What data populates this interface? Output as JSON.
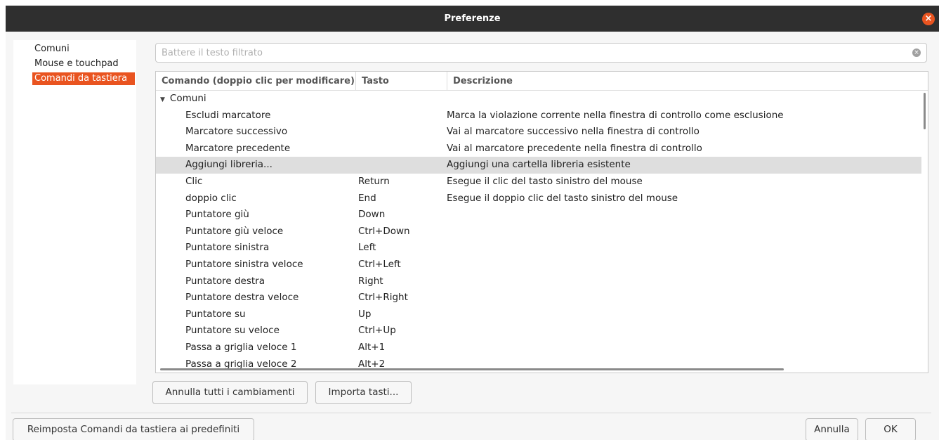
{
  "window": {
    "title": "Preferenze"
  },
  "sidebar": {
    "items": [
      {
        "label": "Comuni"
      },
      {
        "label": "Mouse e touchpad"
      },
      {
        "label": "Comandi da tastiera"
      }
    ],
    "active_index": 2
  },
  "filter": {
    "placeholder": "Battere il testo filtrato",
    "value": ""
  },
  "table": {
    "columns": [
      "Comando (doppio clic per modificare)",
      "Tasto",
      "Descrizione"
    ],
    "group": "Comuni",
    "rows": [
      {
        "command": "Escludi marcatore",
        "key": "",
        "description": "Marca la violazione corrente nella finestra di controllo come esclusione"
      },
      {
        "command": "Marcatore successivo",
        "key": "",
        "description": "Vai al marcatore successivo nella finestra di controllo"
      },
      {
        "command": "Marcatore precedente",
        "key": "",
        "description": "Vai al marcatore precedente nella finestra di controllo"
      },
      {
        "command": "Aggiungi libreria...",
        "key": "",
        "description": "Aggiungi una cartella libreria esistente",
        "selected": true
      },
      {
        "command": "Clic",
        "key": "Return",
        "description": "Esegue il clic del tasto sinistro del mouse"
      },
      {
        "command": "doppio clic",
        "key": "End",
        "description": "Esegue il doppio clic del tasto sinistro del mouse"
      },
      {
        "command": "Puntatore giù",
        "key": "Down",
        "description": ""
      },
      {
        "command": "Puntatore giù veloce",
        "key": "Ctrl+Down",
        "description": ""
      },
      {
        "command": "Puntatore sinistra",
        "key": "Left",
        "description": ""
      },
      {
        "command": "Puntatore sinistra veloce",
        "key": "Ctrl+Left",
        "description": ""
      },
      {
        "command": "Puntatore destra",
        "key": "Right",
        "description": ""
      },
      {
        "command": "Puntatore destra veloce",
        "key": "Ctrl+Right",
        "description": ""
      },
      {
        "command": "Puntatore su",
        "key": "Up",
        "description": ""
      },
      {
        "command": "Puntatore su veloce",
        "key": "Ctrl+Up",
        "description": ""
      },
      {
        "command": "Passa a griglia veloce 1",
        "key": "Alt+1",
        "description": ""
      },
      {
        "command": "Passa a griglia veloce 2",
        "key": "Alt+2",
        "description": ""
      }
    ]
  },
  "buttons": {
    "undo_all": "Annulla tutti i cambiamenti",
    "import_keys": "Importa tasti...",
    "reset_defaults": "Reimposta Comandi da tastiera ai predefiniti",
    "cancel": "Annulla",
    "ok": "OK"
  },
  "colors": {
    "accent": "#e95420",
    "titlebar": "#2f2f2f",
    "selected_row": "#dedede"
  }
}
